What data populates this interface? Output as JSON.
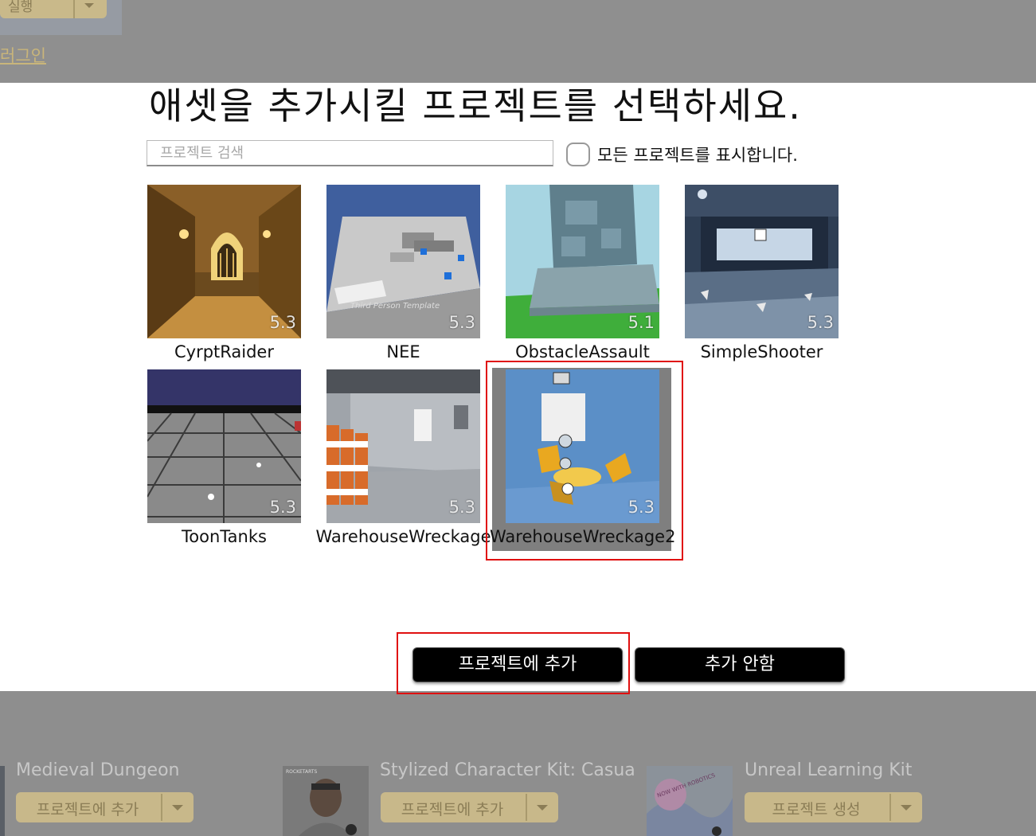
{
  "background": {
    "run_button_label": "실행",
    "plugin_link": "러그인",
    "cards": [
      {
        "title": "Medieval Dungeon",
        "button_label": "프로젝트에 추가"
      },
      {
        "title": "Stylized Character Kit: Casua",
        "button_label": "프로젝트에 추가",
        "thumb_text": "ROCKETARTS"
      },
      {
        "title": "Unreal Learning Kit",
        "button_label": "프로젝트 생성",
        "thumb_text": "NOW WITH ROBOTICS"
      }
    ]
  },
  "dialog": {
    "title": "애셋을 추가시킬 프로젝트를 선택하세요.",
    "search_placeholder": "프로젝트 검색",
    "show_all_label": "모든 프로젝트를 표시합니다.",
    "show_all_checked": false,
    "projects": [
      {
        "name": "CyrptRaider",
        "version": "5.3"
      },
      {
        "name": "NEE",
        "version": "5.3",
        "thumb_caption": "Third Person Template"
      },
      {
        "name": "ObstacleAssault",
        "version": "5.1"
      },
      {
        "name": "SimpleShooter",
        "version": "5.3"
      },
      {
        "name": "ToonTanks",
        "version": "5.3"
      },
      {
        "name": "WarehouseWreckage",
        "version": "5.3"
      },
      {
        "name": "WarehouseWreckage2",
        "version": "5.3",
        "selected": true
      }
    ],
    "add_button": "프로젝트에 추가",
    "cancel_button": "추가 안함"
  },
  "colors": {
    "highlight": "#e01010",
    "button_bg": "#000000",
    "bg_button": "#c8b88a"
  }
}
